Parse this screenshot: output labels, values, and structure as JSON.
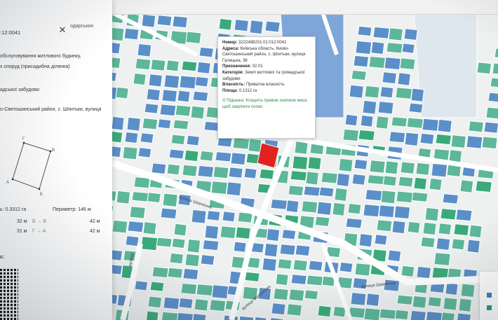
{
  "panel": {
    "top_partial": "одарських",
    "cadastre_partial": ":12:0041",
    "purpose_line1": "обслуговування житлового будинку,",
    "purpose_line2": "х споруд (присадибна ділянка)",
    "category_partial": "адської забудови",
    "address_line": "о-Святошинський район, с. Шпитьки, вулиця",
    "vertex_top": "Г",
    "vertex_right": "В",
    "vertex_bottom": "Б",
    "vertex_left": "А",
    "area_label": "ь: 0.3312 га",
    "perimeter_label": "Периметр: 146 м",
    "sides": [
      {
        "len1": "32 м",
        "seg": "Б → В",
        "len2": "42 м"
      },
      {
        "len1": "31 м",
        "seg": "Г → А",
        "len2": "42 м"
      }
    ],
    "qr_heading": "с:",
    "close_symbol": "✕"
  },
  "popup": {
    "number_label": "Номер:",
    "number_value": "3222488201:01:012:0041",
    "address_label": "Адреса:",
    "address_value": "Київська область, Києво-Святошинський район, с. Шпитьки, вулиця Галицька, 36",
    "purpose_label": "Призначення:",
    "purpose_value": "02.01",
    "category_label": "Категорія:",
    "category_value": "Землі житлової та громадської забудови",
    "ownership_label": "Власність:",
    "ownership_value": "Приватна власність",
    "area_label": "Площа:",
    "area_value": "0.1312 га",
    "hint_label": "Підказка:",
    "hint_value": "Клацніть правою кнопкою миші, щоб закріпити попап"
  },
  "streets": {
    "shevchenka_1": "вулиця Шевченка",
    "shevchenka_2": "вулиця Шевченка",
    "vertical_1": "вулиця",
    "vertical_2": "вулиця Матросова"
  },
  "legend": {
    "swatch_colors": [
      "#3f7fb5",
      "#2a9a78"
    ]
  },
  "colors": {
    "parcel_blue": "#5b8fc9",
    "parcel_teal": "#5db79a",
    "parcel_green": "#3aaa7a",
    "selected": "#e0231f",
    "road": "#ffffff",
    "block_blue": "#7fa6d8"
  }
}
